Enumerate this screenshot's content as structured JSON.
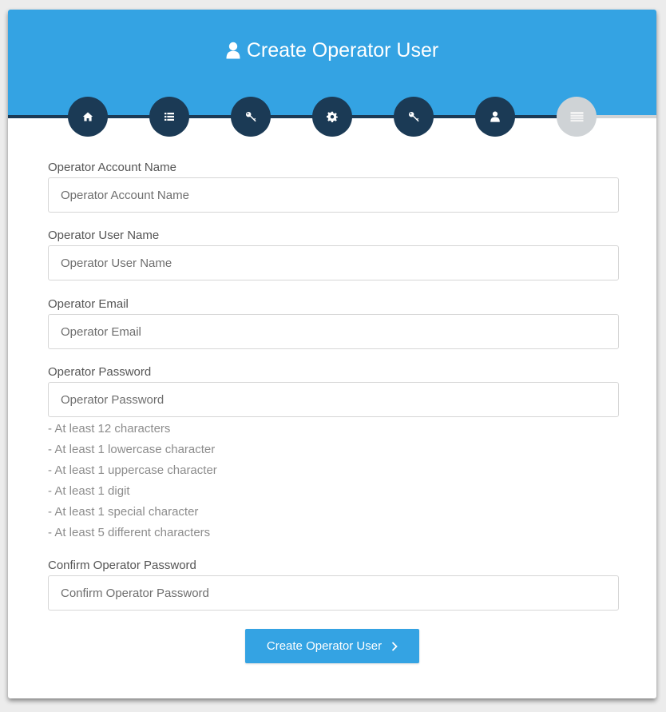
{
  "header": {
    "title": "Create Operator User",
    "title_icon": "user-icon",
    "background_color": "#34a3e3"
  },
  "wizard": {
    "steps": [
      {
        "icon": "home-icon",
        "state": "completed"
      },
      {
        "icon": "list-icon",
        "state": "completed"
      },
      {
        "icon": "key-icon",
        "state": "completed"
      },
      {
        "icon": "gear-icon",
        "state": "completed"
      },
      {
        "icon": "key-icon",
        "state": "completed"
      },
      {
        "icon": "user-icon",
        "state": "completed"
      },
      {
        "icon": "table-icon",
        "state": "pending"
      }
    ],
    "completed_color": "#1b3a55",
    "pending_color": "#cfd3d6"
  },
  "form": {
    "account_name": {
      "label": "Operator Account Name",
      "placeholder": "Operator Account Name",
      "value": ""
    },
    "user_name": {
      "label": "Operator User Name",
      "placeholder": "Operator User Name",
      "value": ""
    },
    "email": {
      "label": "Operator Email",
      "placeholder": "Operator Email",
      "value": ""
    },
    "password": {
      "label": "Operator Password",
      "placeholder": "Operator Password",
      "value": ""
    },
    "password_rules": [
      "- At least 12 characters",
      "- At least 1 lowercase character",
      "- At least 1 uppercase character",
      "- At least 1 digit",
      "- At least 1 special character",
      "- At least 5 different characters"
    ],
    "confirm_password": {
      "label": "Confirm Operator Password",
      "placeholder": "Confirm Operator Password",
      "value": ""
    },
    "submit_label": "Create Operator User",
    "submit_icon": "chevron-right-icon"
  }
}
